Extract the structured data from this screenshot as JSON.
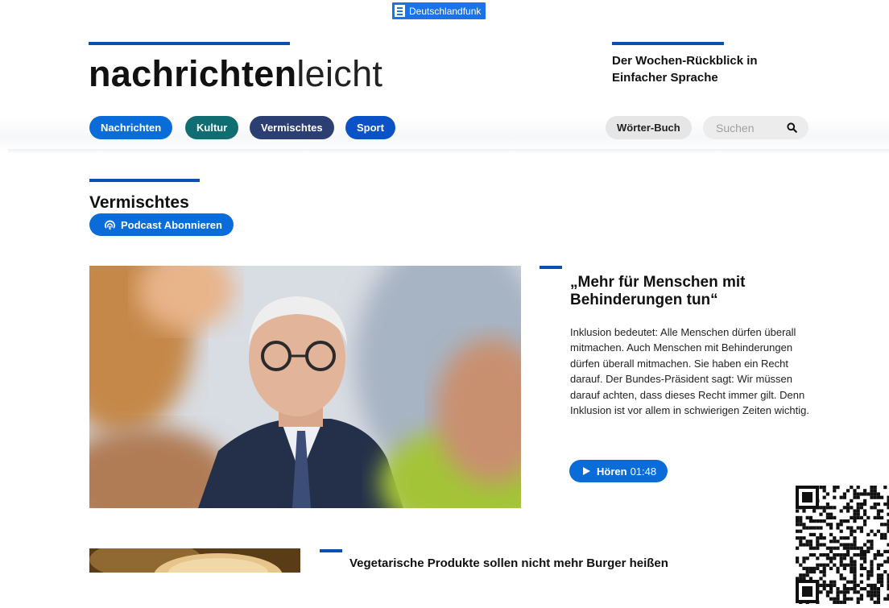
{
  "brand": {
    "broadcaster": "Deutschlandfunk",
    "logo_bold": "nachrichten",
    "logo_light": "leicht",
    "tagline": "Der Wochen-Rückblick in Einfacher Sprache"
  },
  "nav": {
    "items": [
      {
        "label": "Nachrichten",
        "color": "#0a6cd8"
      },
      {
        "label": "Kultur",
        "color": "#106e72"
      },
      {
        "label": "Vermischtes",
        "color": "#2b3f73"
      },
      {
        "label": "Sport",
        "color": "#0b52c6"
      }
    ],
    "dictionary_label": "Wörter-Buch",
    "search_placeholder": "Suchen",
    "search_icon": "magnifier-icon"
  },
  "section": {
    "title": "Vermischtes",
    "podcast_label": "Podcast Abonnieren",
    "podcast_icon": "podcast-icon"
  },
  "articles": [
    {
      "title": "„Mehr für Menschen mit Behinderungen tun“",
      "text": "Inklusion bedeutet: Alle Menschen dürfen überall mitmachen. Auch Menschen mit Behinderungen dürfen überall mitmachen. Sie haben ein Recht darauf. Der Bundes-Präsident sagt: Wir müssen darauf achten, dass dieses Recht immer gilt. Denn Inklusion ist vor allem in schwierigen Zeiten wichtig.",
      "listen_label": "Hören",
      "duration": "01:48",
      "image": "photo-elderly-man-glasses"
    },
    {
      "title": "Vegetarische Produkte sollen nicht mehr Burger heißen",
      "image": "photo-burger-bun"
    }
  ],
  "colors": {
    "accent": "#0a4fb4",
    "button_blue": "#0a6cd8"
  }
}
